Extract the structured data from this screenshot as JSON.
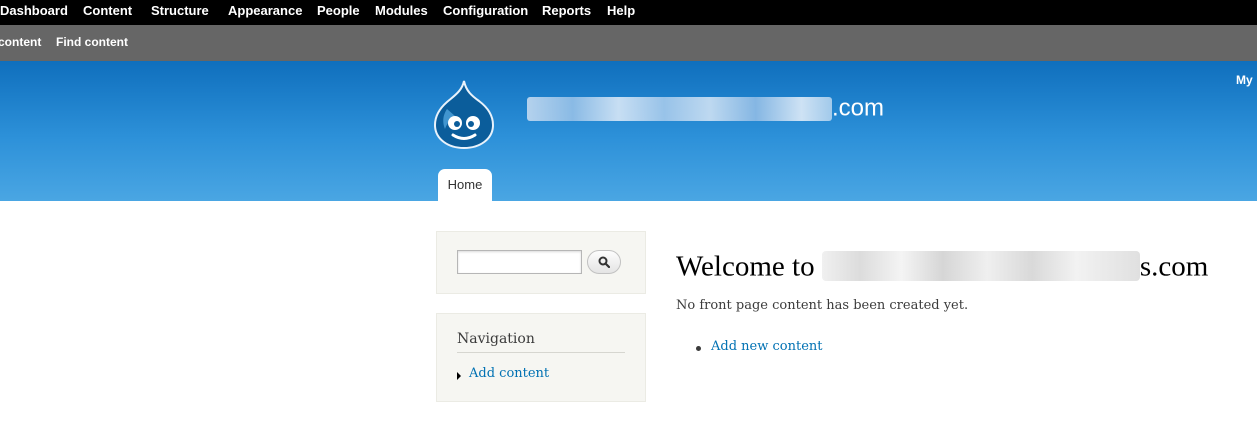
{
  "admin_toolbar": {
    "items": [
      {
        "label": "Dashboard"
      },
      {
        "label": "Content"
      },
      {
        "label": "Structure"
      },
      {
        "label": "Appearance"
      },
      {
        "label": "People"
      },
      {
        "label": "Modules"
      },
      {
        "label": "Configuration"
      },
      {
        "label": "Reports"
      },
      {
        "label": "Help"
      }
    ]
  },
  "shortcuts": {
    "items": [
      {
        "label": "content"
      },
      {
        "label": "Find content"
      }
    ]
  },
  "header": {
    "my_account": "My",
    "site_name_suffix": ".com",
    "tab_home": "Home",
    "colors": {
      "top": "#0f6fbd",
      "bottom": "#4aa6e3"
    },
    "logo_icon": "drupal-drop-logo"
  },
  "sidebar": {
    "search": {
      "placeholder": "",
      "value": "",
      "button_icon": "search-icon"
    },
    "navigation": {
      "title": "Navigation",
      "links": [
        {
          "label": "Add content"
        }
      ]
    }
  },
  "main": {
    "title_prefix": "Welcome to ",
    "title_suffix": "s.com",
    "message": "No front page content has been created yet.",
    "links": [
      {
        "label": "Add new content"
      }
    ]
  },
  "colors": {
    "link": "#0071b3",
    "admin_bar": "#000000",
    "shortcut_bar": "#666666"
  }
}
